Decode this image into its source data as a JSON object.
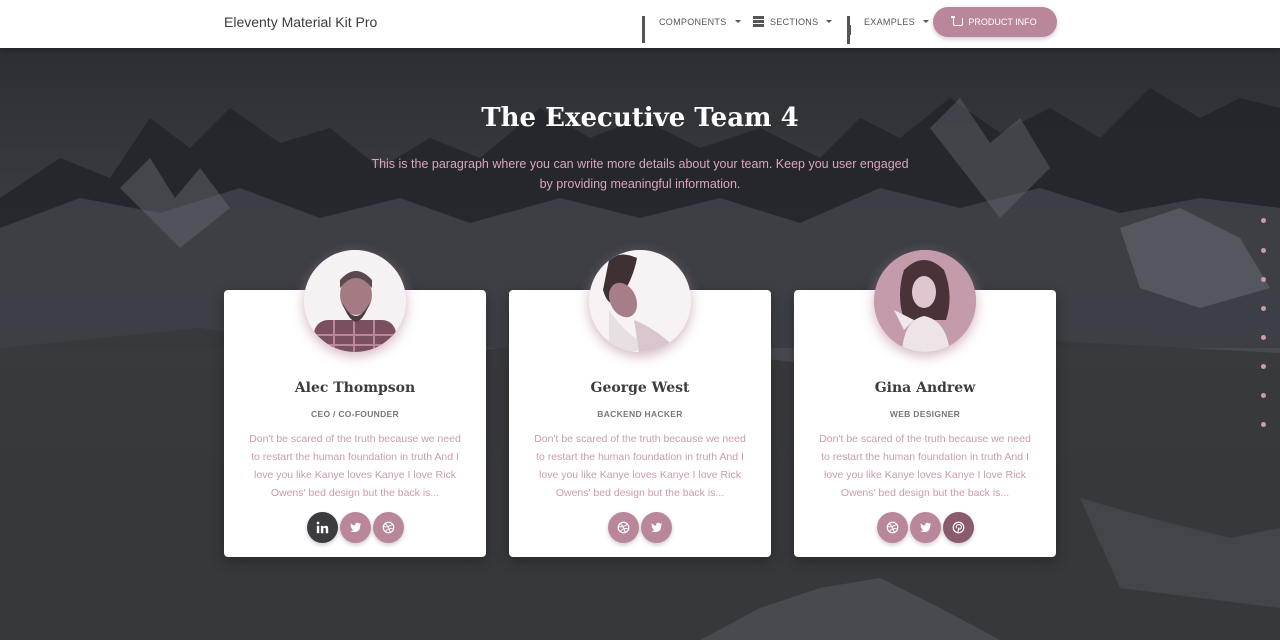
{
  "navbar": {
    "brand": "Eleventy Material Kit Pro",
    "components_label": "COMPONENTS",
    "sections_label": "SECTIONS",
    "examples_label": "EXAMPLES",
    "product_info_label": "PRODUCT INFO"
  },
  "hero": {
    "title": "The Executive Team 4",
    "subtitle": "This is the paragraph where you can write more details about your team. Keep you user engaged by providing meaningful information."
  },
  "team": [
    {
      "name": "Alec Thompson",
      "role": "CEO / CO-FOUNDER",
      "description": "Don't be scared of the truth because we need to restart the human foundation in truth And I love you like Kanye loves Kanye I love Rick Owens' bed design but the back is...",
      "socials": [
        "linkedin-icon",
        "twitter-icon",
        "dribbble-icon"
      ]
    },
    {
      "name": "George West",
      "role": "BACKEND HACKER",
      "description": "Don't be scared of the truth because we need to restart the human foundation in truth And I love you like Kanye loves Kanye I love Rick Owens' bed design but the back is...",
      "socials": [
        "dribbble-icon",
        "twitter-icon"
      ]
    },
    {
      "name": "Gina Andrew",
      "role": "WEB DESIGNER",
      "description": "Don't be scared of the truth because we need to restart the human foundation in truth And I love you like Kanye loves Kanye I love Rick Owens' bed design but the back is...",
      "socials": [
        "dribbble-icon",
        "twitter-icon",
        "pinterest-icon"
      ]
    }
  ],
  "section_nav_dots": 8,
  "colors": {
    "accent": "#b9869b",
    "accent_text": "#c99cb0",
    "dark_button": "#3c3c40",
    "pinterest_button": "#8a5a6f",
    "navbar_bg": "#ffffff"
  }
}
